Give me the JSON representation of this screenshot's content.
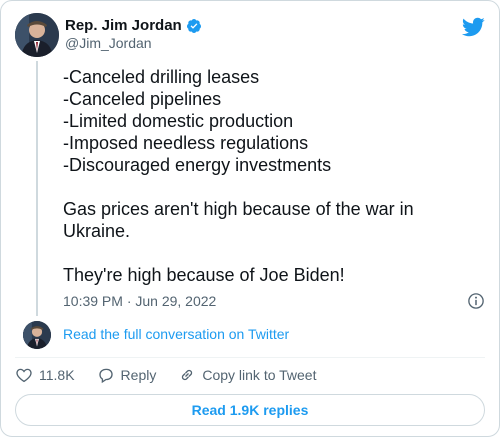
{
  "author": {
    "name": "Rep. Jim Jordan",
    "handle": "@Jim_Jordan"
  },
  "tweet": {
    "lines": [
      "-Canceled drilling leases",
      "-Canceled pipelines",
      "-Limited domestic production",
      "-Imposed needless regulations",
      "-Discouraged energy investments"
    ],
    "paragraph_2": "Gas prices aren't high because of the war in Ukraine.",
    "paragraph_3": "They're high because of Joe Biden!",
    "timestamp": "10:39 PM · Jun 29, 2022"
  },
  "conversation_link": "Read the full conversation on Twitter",
  "actions": {
    "likes": "11.8K",
    "reply_label": "Reply",
    "copy_label": "Copy link to Tweet"
  },
  "read_replies_label": "Read 1.9K replies",
  "colors": {
    "accent": "#1d9bf0",
    "secondary_text": "#536471",
    "border": "#cfd9de"
  }
}
